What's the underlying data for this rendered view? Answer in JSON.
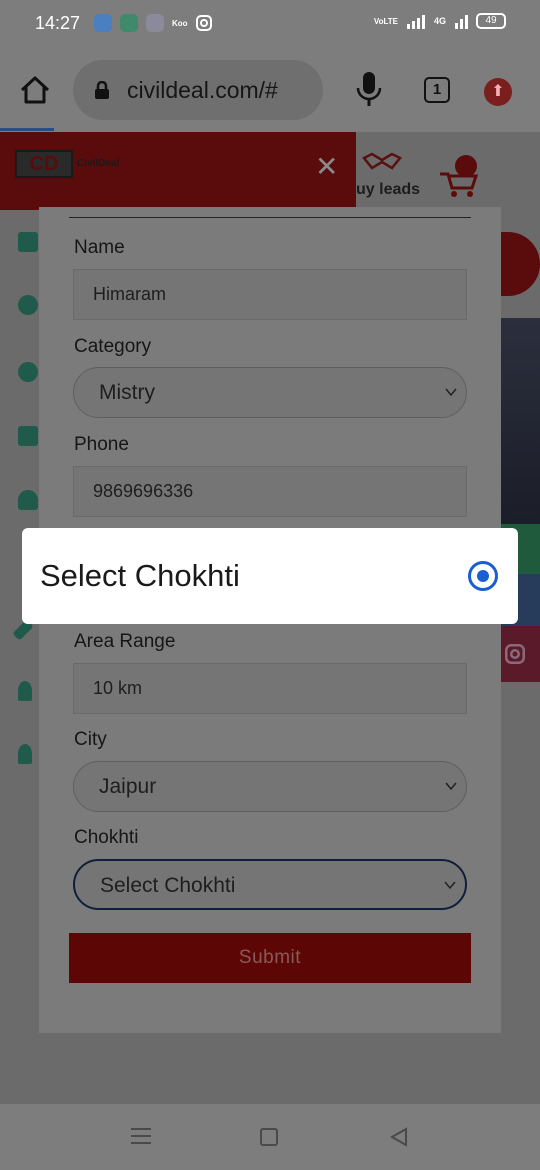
{
  "status_bar": {
    "time": "14:27",
    "battery": "49",
    "network": "4G",
    "volte": "VoLTE"
  },
  "browser": {
    "url": "civildeal.com/#",
    "tab_count": "1"
  },
  "site": {
    "logo": "CD",
    "logo_name": "CivilDeal",
    "buy_leads": "uy leads"
  },
  "form": {
    "name_label": "Name",
    "name_value": "Himaram",
    "category_label": "Category",
    "category_value": "Mistry",
    "phone_label": "Phone",
    "phone_value": "9869696336",
    "area_label": "Area Range",
    "area_value": "10 km",
    "city_label": "City",
    "city_value": "Jaipur",
    "chokhti_label": "Chokhti",
    "chokhti_value": "Select Chokhti",
    "submit_label": "Submit"
  },
  "popup": {
    "option_label": "Select Chokhti",
    "selected": true
  },
  "colors": {
    "brand": "#c00000",
    "radio": "#1a5fd1"
  }
}
